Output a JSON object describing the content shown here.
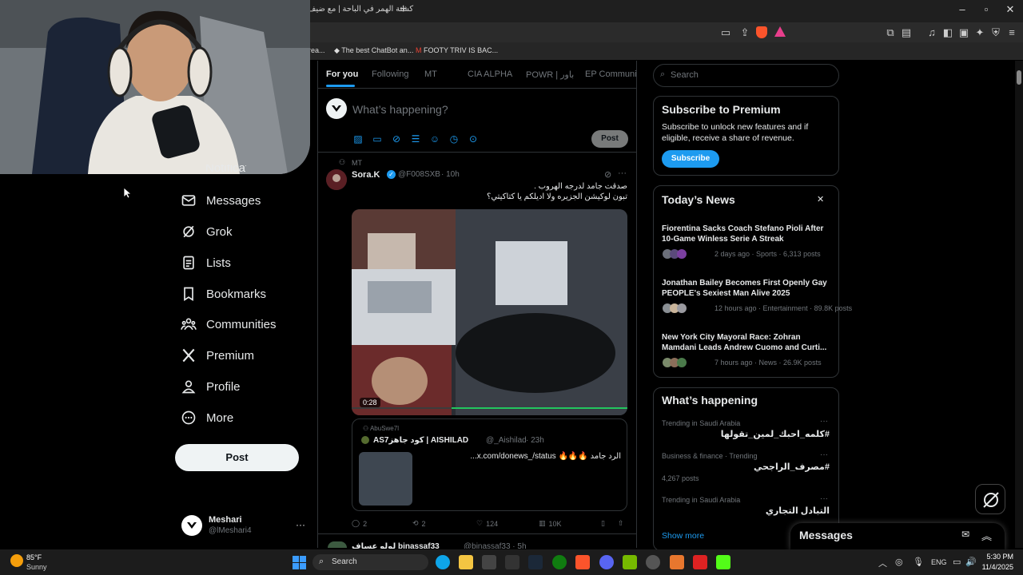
{
  "browser": {
    "tab_title": "(1) كشتة الهمر في الباحة | مع ضيف",
    "newtab": "+",
    "bookmarks": [
      {
        "label": "rea..."
      },
      {
        "label": "The best ChatBot an..."
      },
      {
        "label": "FOOTY TRIV IS BAC..."
      }
    ]
  },
  "nav": {
    "partial_label": "Notifications",
    "items": [
      {
        "label": "Messages",
        "icon": "mail-icon"
      },
      {
        "label": "Grok",
        "icon": "grok-icon"
      },
      {
        "label": "Lists",
        "icon": "list-icon"
      },
      {
        "label": "Bookmarks",
        "icon": "bookmark-icon"
      },
      {
        "label": "Communities",
        "icon": "communities-icon"
      },
      {
        "label": "Premium",
        "icon": "x-logo-icon"
      },
      {
        "label": "Profile",
        "icon": "profile-icon"
      },
      {
        "label": "More",
        "icon": "more-icon"
      }
    ],
    "post_label": "Post",
    "account": {
      "name": "Meshari",
      "handle": "@lMeshari4",
      "more": "···"
    }
  },
  "feed": {
    "tabs": [
      {
        "label": "For you",
        "active": true
      },
      {
        "label": "Following",
        "active": false
      },
      {
        "label": "MT",
        "active": false
      },
      {
        "label": "CIA ALPHA",
        "active": false
      },
      {
        "label": "POWR | باور",
        "active": false
      },
      {
        "label": "EP Communit",
        "active": false
      }
    ],
    "composer": {
      "placeholder": "What’s happening?",
      "post_label": "Post"
    },
    "tweet": {
      "community": "MT",
      "name": "Sora.K",
      "handle": "@F008SXB",
      "time": "· 10h",
      "text_line1": "صدقت جامد لدرجه الهروب .",
      "text_line2": "تبون لوكيشن الجزيره ولا اديلكم يا كتاكيتي؟",
      "video_duration": "0:28",
      "quote": {
        "community": "AbuSwe7l",
        "name": "AS7كود جاهز | AISHILAD",
        "handle": "@_Aishilad",
        "time": "· 23h",
        "text": "الرد جامد 🔥🔥🔥 x.com/donews_/status..."
      },
      "stats": {
        "replies": "2",
        "reposts": "2",
        "likes": "124",
        "views": "10K"
      }
    },
    "next_tweet_name": "لولو عساف binassaf33",
    "next_tweet_handle": "@binassaf33 · 5h"
  },
  "right": {
    "search_placeholder": "Search",
    "premium": {
      "title": "Subscribe to Premium",
      "body": "Subscribe to unlock new features and if eligible, receive a share of revenue.",
      "button": "Subscribe"
    },
    "news": {
      "title": "Today’s News",
      "close": "✕",
      "items": [
        {
          "title": "Fiorentina Sacks Coach Stefano Pioli After 10-Game Winless Serie A Streak",
          "meta": "2 days ago · Sports · 6,313 posts"
        },
        {
          "title": "Jonathan Bailey Becomes First Openly Gay PEOPLE's Sexiest Man Alive 2025",
          "meta": "12 hours ago · Entertainment · 89.8K posts"
        },
        {
          "title": "New York City Mayoral Race: Zohran Mamdani Leads Andrew Cuomo and Curti...",
          "meta": "7 hours ago · News · 26.9K posts"
        }
      ]
    },
    "happening": {
      "title": "What’s happening",
      "items": [
        {
          "meta": "Trending in Saudi Arabia",
          "title": "#كلمه_احبك_لمين_تقولها",
          "posts": ""
        },
        {
          "meta": "Business & finance · Trending",
          "title": "#مصرف_الراجحي",
          "posts": "4,267 posts"
        },
        {
          "meta": "Trending in Saudi Arabia",
          "title": "التبادل التجاري",
          "posts": ""
        }
      ],
      "show_more": "Show more"
    },
    "messages_label": "Messages"
  },
  "taskbar": {
    "weather_temp": "85°F",
    "weather_desc": "Sunny",
    "search": "Search",
    "lang": "ENG",
    "time": "5:30 PM",
    "date": "11/4/2025"
  },
  "colors": {
    "accent": "#1d9bf0",
    "background": "#000000",
    "border": "#2f3336",
    "muted": "#71767b"
  }
}
